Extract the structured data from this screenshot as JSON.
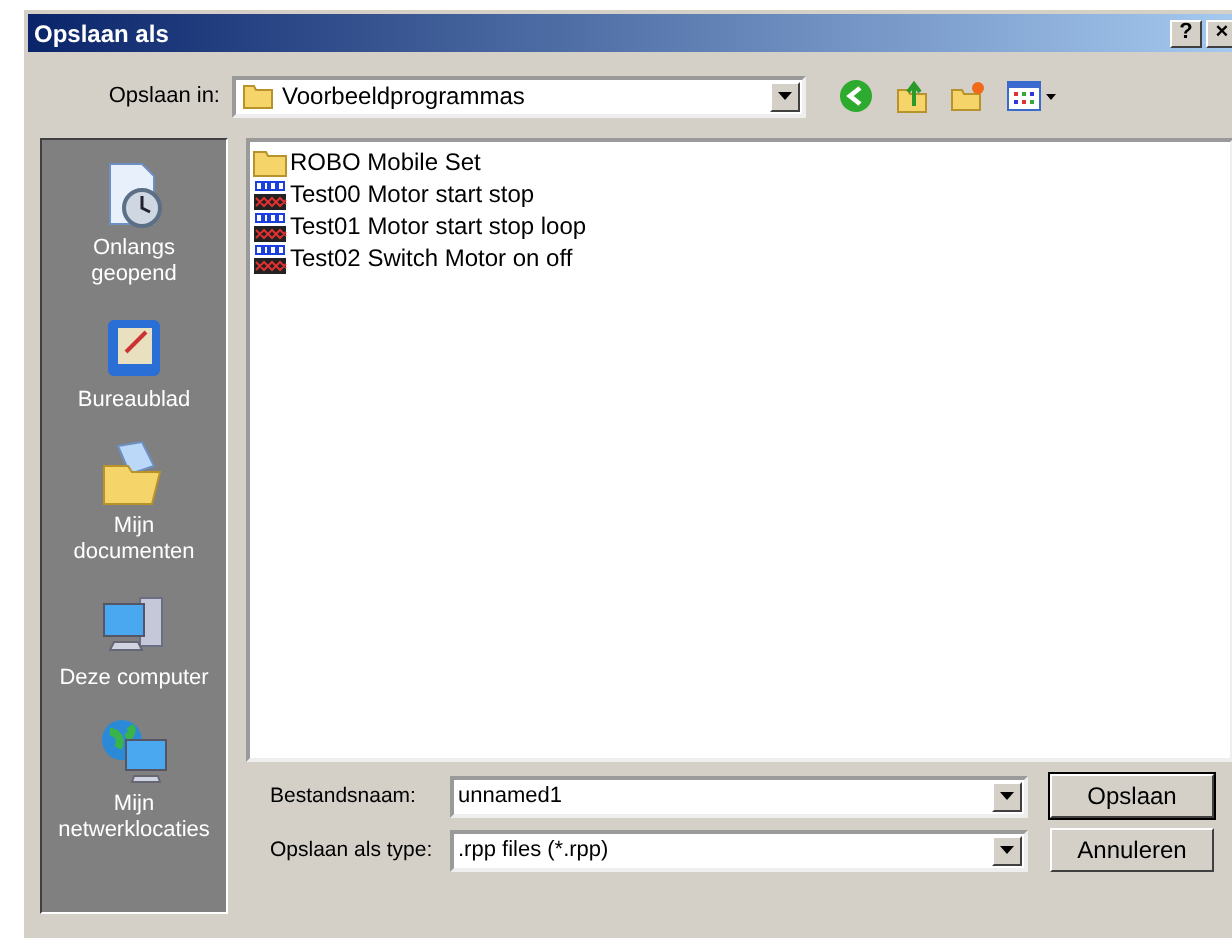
{
  "window": {
    "title": "Opslaan als",
    "help_button": "?",
    "close_button": "×"
  },
  "location": {
    "label": "Opslaan in:",
    "value": "Voorbeeldprogrammas"
  },
  "places": [
    {
      "kind": "recent",
      "label": "Onlangs geopend"
    },
    {
      "kind": "desktop",
      "label": "Bureaublad"
    },
    {
      "kind": "documents",
      "label": "Mijn documenten"
    },
    {
      "kind": "computer",
      "label": "Deze computer"
    },
    {
      "kind": "network",
      "label": "Mijn netwerklocaties"
    }
  ],
  "files": [
    {
      "kind": "folder",
      "name": "ROBO Mobile Set"
    },
    {
      "kind": "program",
      "name": "Test00 Motor start stop"
    },
    {
      "kind": "program",
      "name": "Test01 Motor start stop loop"
    },
    {
      "kind": "program",
      "name": "Test02 Switch Motor on off"
    }
  ],
  "filename": {
    "label": "Bestandsnaam:",
    "value": "unnamed1"
  },
  "filetype": {
    "label": "Opslaan als type:",
    "value": ".rpp files (*.rpp)"
  },
  "buttons": [
    "Opslaan",
    "Annuleren"
  ]
}
